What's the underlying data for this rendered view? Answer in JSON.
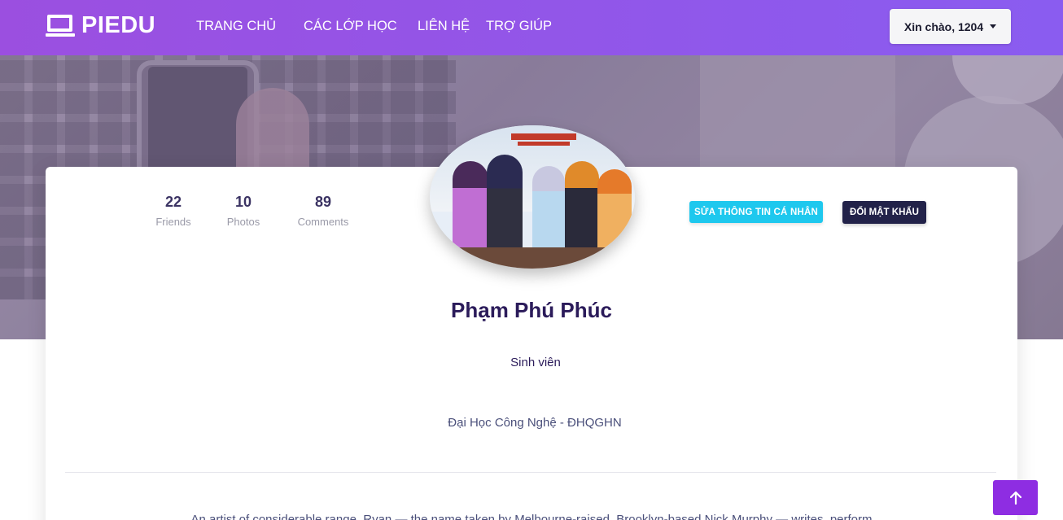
{
  "brand": {
    "name": "PIEDU",
    "icon": "monitor-icon"
  },
  "nav": {
    "items": [
      "TRANG CHỦ",
      "CÁC LỚP HỌC",
      "LIÊN HỆ",
      "TRỢ GIÚP"
    ]
  },
  "user_menu": {
    "label": "Xin chào, 1204"
  },
  "stats": [
    {
      "value": "22",
      "label": "Friends"
    },
    {
      "value": "10",
      "label": "Photos"
    },
    {
      "value": "89",
      "label": "Comments"
    }
  ],
  "profile": {
    "name": "Phạm Phú Phúc",
    "role": "Sinh viên",
    "school": "Đại Học Công Nghệ - ĐHQGHN",
    "bio": "An artist of considerable range, Ryan — the name taken by Melbourne-raised, Brooklyn-based Nick Murphy — writes, perform"
  },
  "actions": {
    "edit_label": "SỬA THÔNG TIN CÁ NHÂN",
    "password_label": "ĐỔI MẬT KHẨU"
  },
  "colors": {
    "navbar_start": "#9b4fe0",
    "navbar_end": "#8a5cf0",
    "edit_button": "#1ec8ee",
    "password_button": "#222249",
    "scroll_top": "#8e2de2"
  },
  "scroll_top": {
    "icon": "arrow-up-icon"
  }
}
